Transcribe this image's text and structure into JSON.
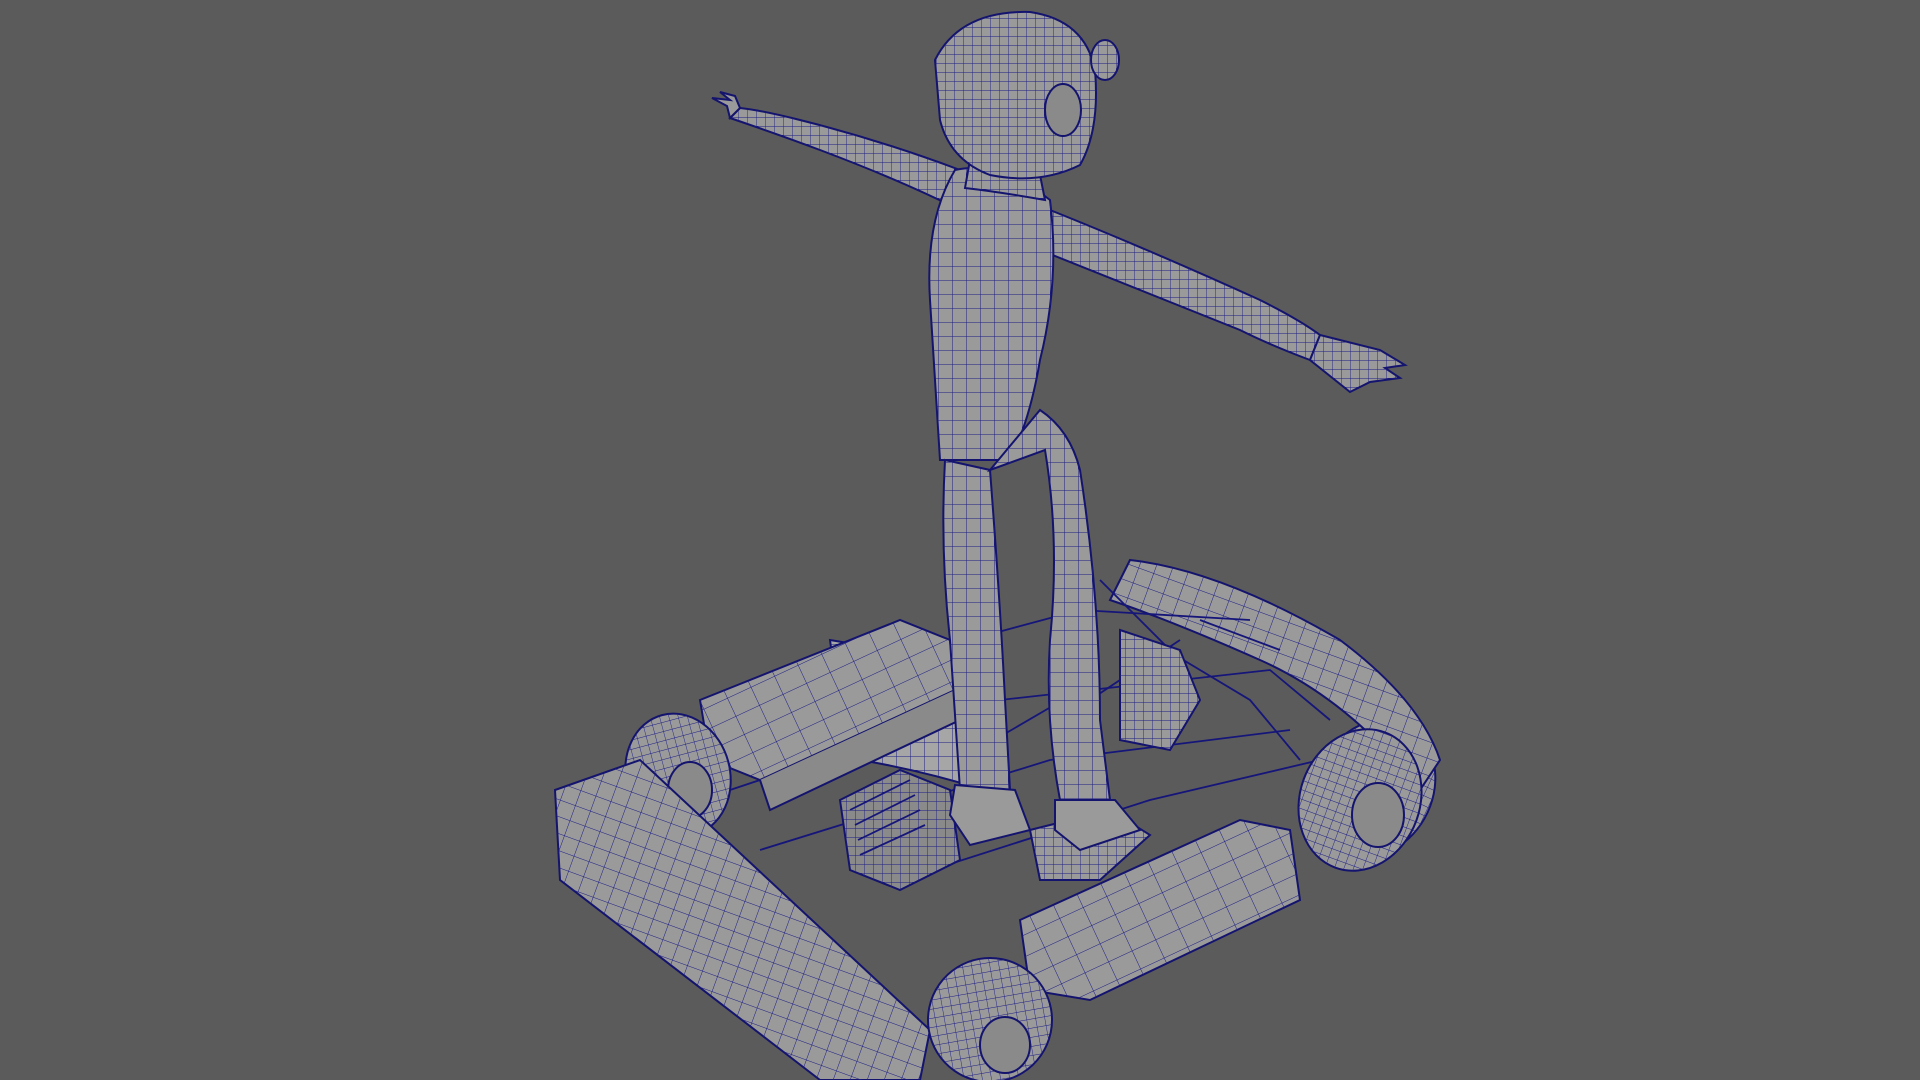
{
  "viewport": {
    "background_color": "#5b5b5b",
    "mesh_color": "#9a9a9a",
    "wireframe_color": "#1c1c86",
    "display_mode": "wireframe-on-shaded"
  },
  "scene": {
    "objects": [
      "character-t-pose",
      "go-kart"
    ]
  }
}
